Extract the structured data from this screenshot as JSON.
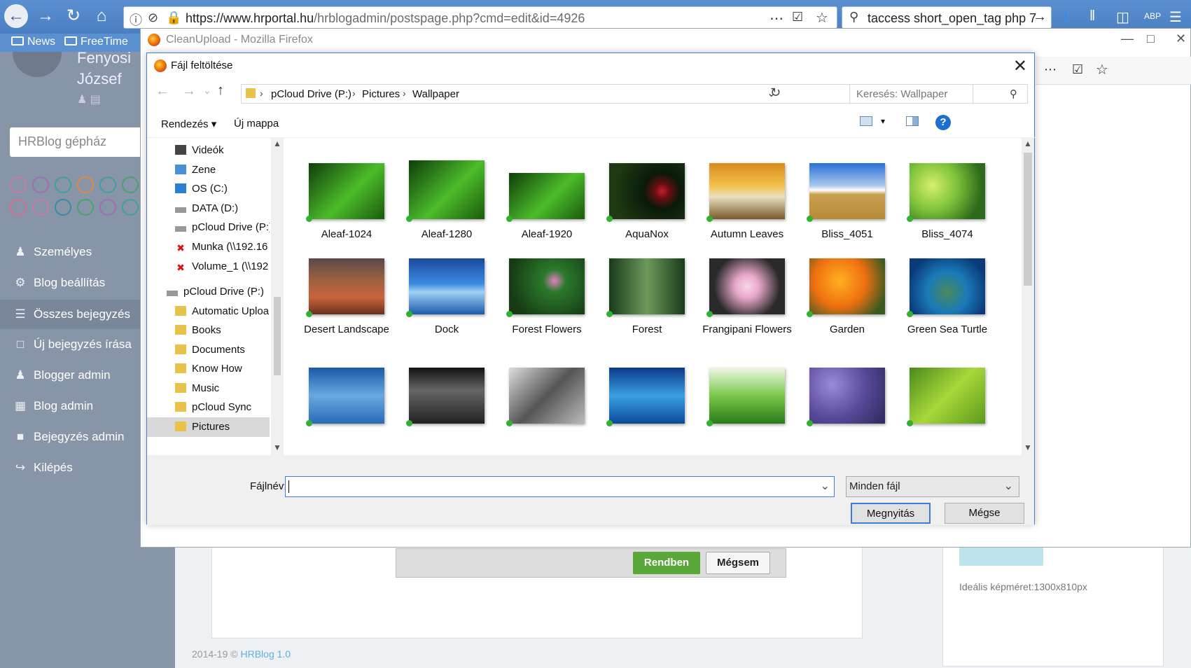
{
  "browser": {
    "url_host": "https://www.hrportal.hu",
    "url_path": "/hrblogadmin/postspage.php?cmd=edit&id=4926",
    "search_query": "taccess short_open_tag php 7",
    "bookmarks": [
      "News",
      "FreeTime"
    ]
  },
  "page": {
    "user_name_1": "Fenyosi",
    "user_name_2": "József",
    "search_placeholder": "HRBlog gépház",
    "menu": [
      {
        "label": "Személyes",
        "icon": "user-icon"
      },
      {
        "label": "Blog beállítás",
        "icon": "gear-icon"
      },
      {
        "label": "Összes bejegyzés",
        "icon": "list-icon"
      },
      {
        "label": "Új bejegyzés írása",
        "icon": "document-icon"
      },
      {
        "label": "Blogger admin",
        "icon": "users-icon"
      },
      {
        "label": "Blog admin",
        "icon": "grid-icon"
      },
      {
        "label": "Bejegyzés admin",
        "icon": "lock-icon"
      },
      {
        "label": "Kilépés",
        "icon": "logout-icon"
      }
    ],
    "ok_label": "Rendben",
    "cancel_label": "Mégsem",
    "image_size_hint": "Ideális képméret:1300x810px",
    "footer_years": "2014-19 ©",
    "footer_link": "HRBlog 1.0",
    "circle_colors": [
      "#c77aa8",
      "#9b6fb0",
      "#3aa39a",
      "#e08a3c",
      "#3aa39a",
      "#4aa36a"
    ]
  },
  "popup": {
    "title": "CleanUpload - Mozilla Firefox"
  },
  "dialog": {
    "title": "Fájl feltöltése",
    "path": [
      "pCloud Drive (P:)",
      "Pictures",
      "Wallpaper"
    ],
    "search_placeholder": "Keresés: Wallpaper",
    "organize": "Rendezés",
    "new_folder": "Új mappa",
    "nav_items": [
      {
        "label": "Videók",
        "type": "video"
      },
      {
        "label": "Zene",
        "type": "music"
      },
      {
        "label": "OS (C:)",
        "type": "drive"
      },
      {
        "label": "DATA (D:)",
        "type": "drive"
      },
      {
        "label": "pCloud Drive (P:)",
        "type": "drive"
      },
      {
        "label": "Munka (\\\\192.16",
        "type": "netx"
      },
      {
        "label": "Volume_1 (\\\\192",
        "type": "netx"
      },
      {
        "label": "pCloud Drive (P:)",
        "type": "drive2"
      },
      {
        "label": "Automatic Uploa",
        "type": "folder"
      },
      {
        "label": "Books",
        "type": "folder"
      },
      {
        "label": "Documents",
        "type": "folder"
      },
      {
        "label": "Know How",
        "type": "folder"
      },
      {
        "label": "Music",
        "type": "folder"
      },
      {
        "label": "pCloud Sync",
        "type": "folder"
      },
      {
        "label": "Pictures",
        "type": "folder"
      }
    ],
    "files": [
      "Aleaf-1024",
      "Aleaf-1280",
      "Aleaf-1920",
      "AquaNox",
      "Autumn Leaves",
      "Bliss_4051",
      "Bliss_4074",
      "Desert Landscape",
      "Dock",
      "Forest Flowers",
      "Forest",
      "Frangipani Flowers",
      "Garden",
      "Green Sea Turtle",
      "",
      "",
      "",
      "",
      "",
      "",
      ""
    ],
    "filename_label": "Fájlnév:",
    "filename_value": "",
    "filetype": "Minden fájl",
    "open_label": "Megnyitás",
    "cancel_label": "Mégse"
  }
}
